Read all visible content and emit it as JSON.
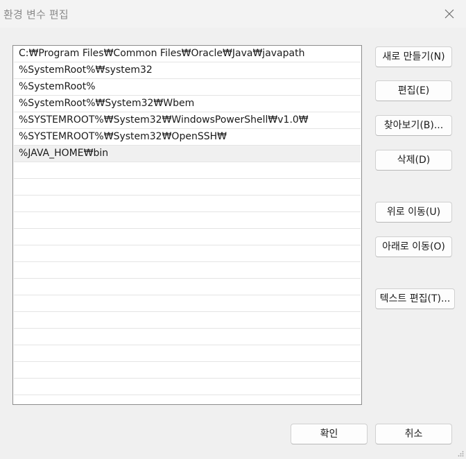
{
  "window": {
    "title": "환경 변수 편집"
  },
  "list": {
    "items": [
      "C:₩Program Files₩Common Files₩Oracle₩Java₩javapath",
      "%SystemRoot%₩system32",
      "%SystemRoot%",
      "%SystemRoot%₩System32₩Wbem",
      "%SYSTEMROOT%₩System32₩WindowsPowerShell₩v1.0₩",
      "%SYSTEMROOT%₩System32₩OpenSSH₩",
      "%JAVA_HOME₩bin"
    ],
    "selected_index": 6
  },
  "buttons": {
    "new": "새로 만들기(N)",
    "edit": "편집(E)",
    "browse": "찾아보기(B)...",
    "delete": "삭제(D)",
    "move_up": "위로 이동(U)",
    "move_down": "아래로 이동(O)",
    "edit_text": "텍스트 편집(T)...",
    "ok": "확인",
    "cancel": "취소"
  },
  "icons": {
    "close": "close-icon",
    "resize": "resize-grip-icon"
  }
}
